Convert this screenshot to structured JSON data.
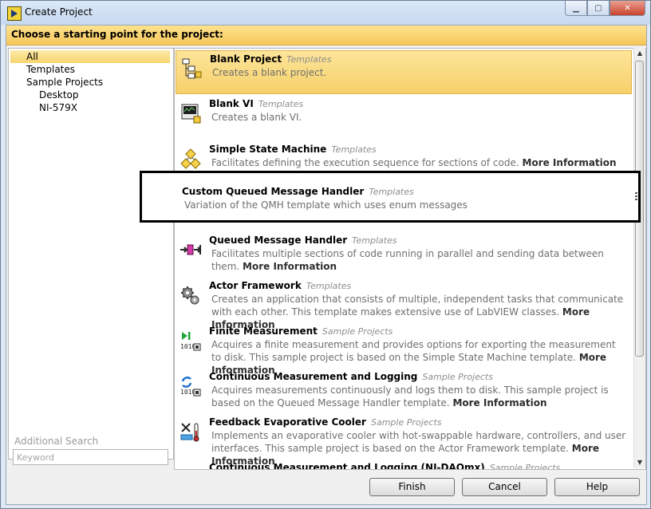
{
  "window": {
    "title": "Create Project"
  },
  "heading": "Choose a starting point for the project:",
  "tree": [
    {
      "label": "All",
      "selected": true
    },
    {
      "label": "Templates"
    },
    {
      "label": "Sample Projects"
    },
    {
      "label": "Desktop"
    },
    {
      "label": "NI-579X"
    }
  ],
  "additional_search": {
    "label": "Additional Search",
    "placeholder": "Keyword"
  },
  "items": [
    {
      "name": "Blank Project",
      "category": "Templates",
      "description": "Creates a blank project.",
      "more": "",
      "icon": "project-tree-icon"
    },
    {
      "name": "Blank VI",
      "category": "Templates",
      "description": "Creates a blank VI.",
      "more": "",
      "icon": "vi-icon"
    },
    {
      "name": "Simple State Machine",
      "category": "Templates",
      "description": "Facilitates defining the execution sequence for sections of code.",
      "more": "More Information",
      "icon": "state-machine-icon"
    },
    {
      "name": "Queued Message Handler",
      "category": "Templates",
      "description": "Facilitates multiple sections of code running in parallel and sending data between them.",
      "more": "More Information",
      "icon": "queue-icon"
    },
    {
      "name": "Actor Framework",
      "category": "Templates",
      "description": "Creates an application that consists of multiple, independent tasks that communicate with each other. This template makes extensive use of LabVIEW classes.",
      "more": "More Information",
      "icon": "gears-icon"
    },
    {
      "name": "Finite Measurement",
      "category": "Sample Projects",
      "description": "Acquires a finite measurement and provides options for exporting the measurement to disk. This sample project is based on the Simple State Machine template.",
      "more": "More Information",
      "icon": "finite-measurement-icon"
    },
    {
      "name": "Continuous Measurement and Logging",
      "category": "Sample Projects",
      "description": "Acquires measurements continuously and logs them to disk. This sample project is based on the Queued Message Handler template.",
      "more": "More Information",
      "icon": "continuous-logging-icon"
    },
    {
      "name": "Feedback Evaporative Cooler",
      "category": "Sample Projects",
      "description": "Implements an evaporative cooler with hot-swappable hardware, controllers, and user interfaces. This sample project is based on the Actor Framework template.",
      "more": "More Information",
      "icon": "cooler-icon"
    },
    {
      "name": "Continuous Measurement and Logging (NI-DAQmx)",
      "category": "Sample Projects",
      "description": "",
      "more": "",
      "icon": "daqmx-icon"
    }
  ],
  "highlighted": {
    "name": "Custom Queued Message Handler",
    "category": "Templates",
    "description": "Variation of the QMH template which uses enum messages"
  },
  "buttons": {
    "finish": "Finish",
    "cancel": "Cancel",
    "help": "Help"
  }
}
